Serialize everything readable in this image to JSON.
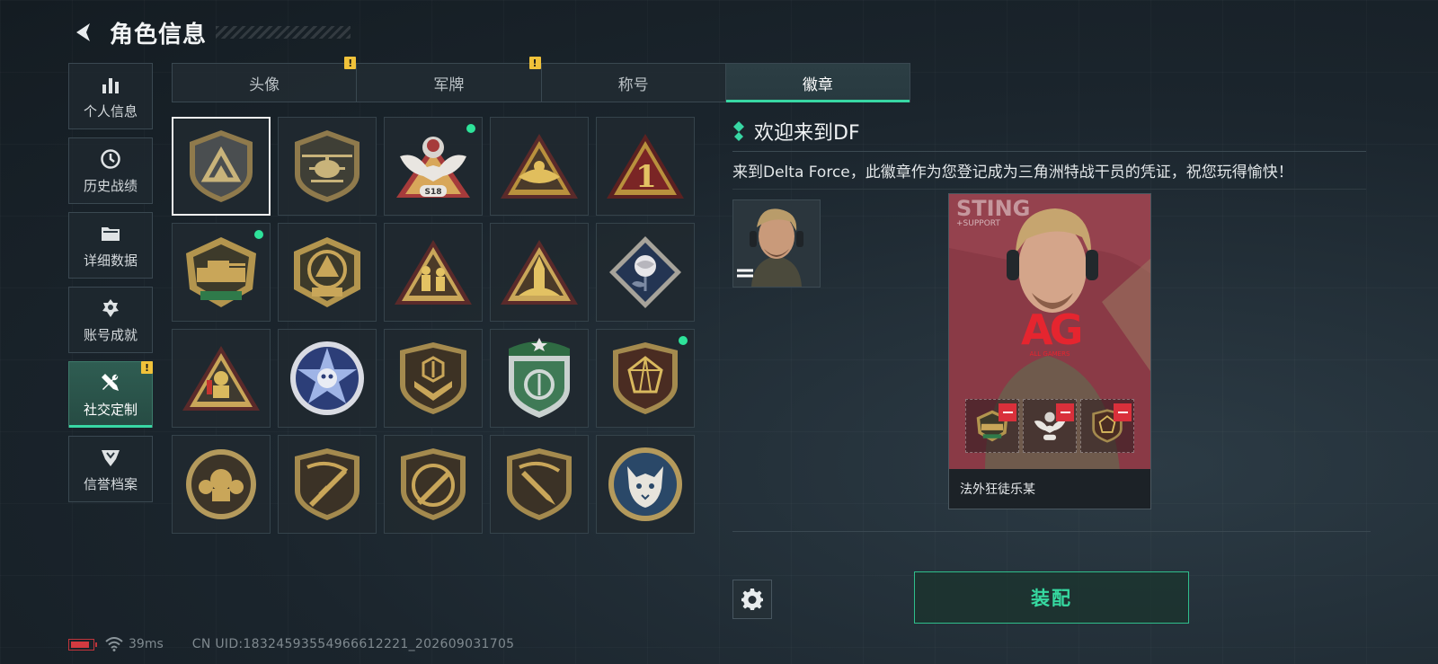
{
  "header": {
    "title": "角色信息",
    "back_icon": "back-arrow-icon"
  },
  "sidebar": {
    "items": [
      {
        "label": "个人信息",
        "icon": "bar-chart-icon",
        "active": false,
        "alert": false
      },
      {
        "label": "历史战绩",
        "icon": "clock-icon",
        "active": false,
        "alert": false
      },
      {
        "label": "详细数据",
        "icon": "folder-icon",
        "active": false,
        "alert": false
      },
      {
        "label": "账号成就",
        "icon": "medal-icon",
        "active": false,
        "alert": false
      },
      {
        "label": "社交定制",
        "icon": "tools-icon",
        "active": true,
        "alert": true
      },
      {
        "label": "信誉档案",
        "icon": "shield-wing-icon",
        "active": false,
        "alert": false
      }
    ]
  },
  "tabs": [
    {
      "label": "头像",
      "active": false,
      "alert": true
    },
    {
      "label": "军牌",
      "active": false,
      "alert": true
    },
    {
      "label": "称号",
      "active": false,
      "alert": false
    },
    {
      "label": "徽章",
      "active": true,
      "alert": false
    }
  ],
  "alert_mark": "!",
  "badges": [
    {
      "name": "delta-shield-badge",
      "selected": true,
      "new": false
    },
    {
      "name": "helicopter-badge",
      "selected": false,
      "new": false
    },
    {
      "name": "s18-eagle-badge",
      "selected": false,
      "new": true
    },
    {
      "name": "nest-triangle-badge",
      "selected": false,
      "new": false
    },
    {
      "name": "number-one-badge",
      "selected": false,
      "new": false
    },
    {
      "name": "delta-force-2026-tank-badge",
      "selected": false,
      "new": true
    },
    {
      "name": "delta-force-2026-badge",
      "selected": false,
      "new": false
    },
    {
      "name": "soldiers-triangle-badge",
      "selected": false,
      "new": false
    },
    {
      "name": "rocket-triangle-badge",
      "selected": false,
      "new": false
    },
    {
      "name": "rose-diamond-badge",
      "selected": false,
      "new": false
    },
    {
      "name": "diver-triangle-badge",
      "selected": false,
      "new": false
    },
    {
      "name": "blue-star-badge",
      "selected": false,
      "new": false
    },
    {
      "name": "chevron-shield-badge",
      "selected": false,
      "new": false
    },
    {
      "name": "green-star-shield-badge",
      "selected": false,
      "new": false
    },
    {
      "name": "gem-shield-badge",
      "selected": false,
      "new": true
    },
    {
      "name": "fist-round-badge",
      "selected": false,
      "new": false
    },
    {
      "name": "rifle-shield-badge",
      "selected": false,
      "new": false
    },
    {
      "name": "rifle-round-shield-badge",
      "selected": false,
      "new": false
    },
    {
      "name": "knife-shield-badge",
      "selected": false,
      "new": false
    },
    {
      "name": "lynx-round-badge",
      "selected": false,
      "new": false
    }
  ],
  "detail": {
    "title": "欢迎来到DF",
    "description": "来到Delta Force，此徽章作为您登记成为三角洲特战干员的凭证，祝您玩得愉快！"
  },
  "card": {
    "name": "法外狂徒乐某",
    "label_top": "STING",
    "label_sub": "+SUPPORT",
    "logo_text": "AG",
    "logo_sub": "ALL GAMERS"
  },
  "buttons": {
    "equip": "装配",
    "settings_icon": "gear-icon"
  },
  "status_bar": {
    "ping": "39ms",
    "uid": "CN UID:18324593554966612221_202609031705",
    "battery_level": 0.85
  },
  "colors": {
    "accent": "#38d7a4",
    "alert": "#f0c23a",
    "new_dot": "#2ee39a",
    "card_bg": "#8e3b48"
  }
}
